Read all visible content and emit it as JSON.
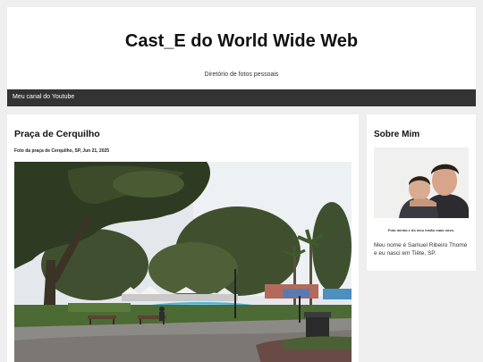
{
  "header": {
    "title": "Cast_E do World Wide Web",
    "description": "Diretório de fotos pessoais"
  },
  "nav": {
    "items": [
      "Meu canal do Youtube"
    ]
  },
  "post": {
    "title": "Praça de Cerquilho",
    "subtitle": "Foto da praça de Cerquilho, SP, Jun 21, 2025"
  },
  "sidebar": {
    "title": "Sobre Mim",
    "photo_caption": "Foto minha e do meu irmão mais novo.",
    "bio": "Meu nome é Samuel Ribeiro Thomé e eu nasci em Tiête, SP."
  }
}
